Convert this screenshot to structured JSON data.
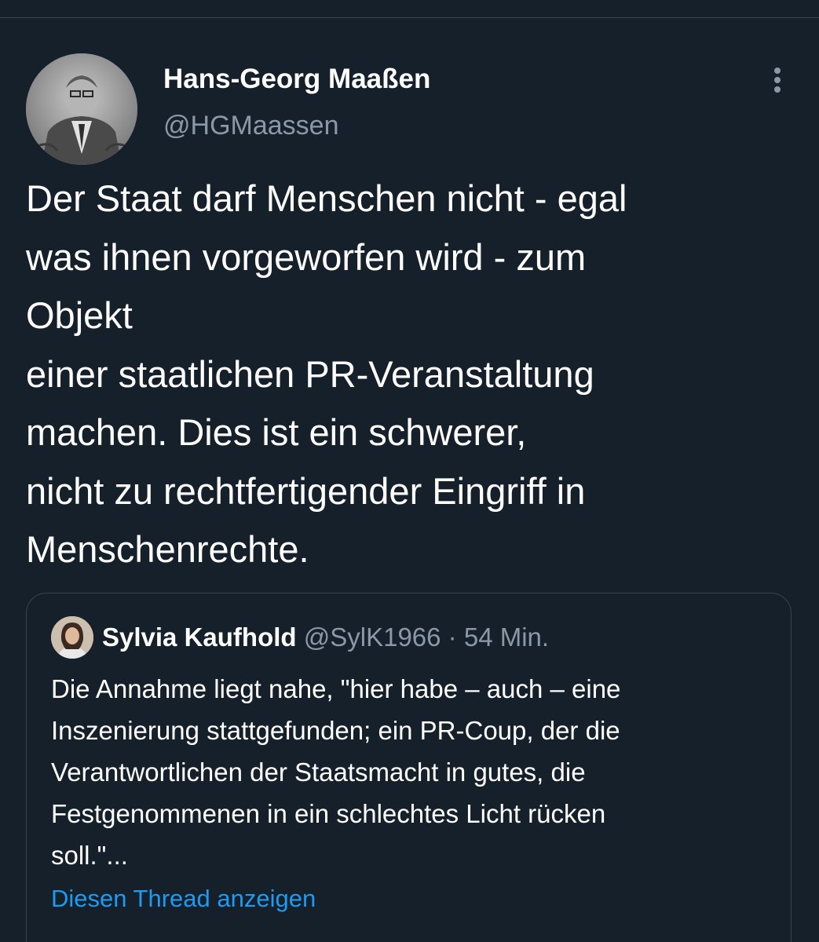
{
  "tweet": {
    "author": {
      "name": "Hans-Georg Maaßen",
      "handle": "@HGMaassen"
    },
    "text": "Der Staat darf Menschen nicht - egal\nwas ihnen vorgeworfen wird - zum\nObjekt\neiner staatlichen PR-Veranstaltung\nmachen. Dies ist ein schwerer,\nnicht zu rechtfertigender Eingriff in\nMenschenrechte."
  },
  "quoted": {
    "author": {
      "name": "Sylvia Kaufhold",
      "handle": "@SylK1966"
    },
    "separator": "·",
    "time": "54 Min.",
    "text": "Die Annahme liegt nahe, \"hier habe – auch – eine\nInszenierung stattgefunden; ein PR-Coup, der die\nVerantwortlichen der Staatsmacht in gutes, die\nFestgenommenen in ein schlechtes Licht rücken\nsoll.\"...",
    "thread_link": "Diesen Thread anzeigen"
  },
  "icons": {
    "more": "more-vertical-icon"
  },
  "colors": {
    "background": "#15202b",
    "text": "#ffffff",
    "secondary_text": "#8b98a5",
    "border": "#38444d",
    "link": "#1d9bf0"
  }
}
